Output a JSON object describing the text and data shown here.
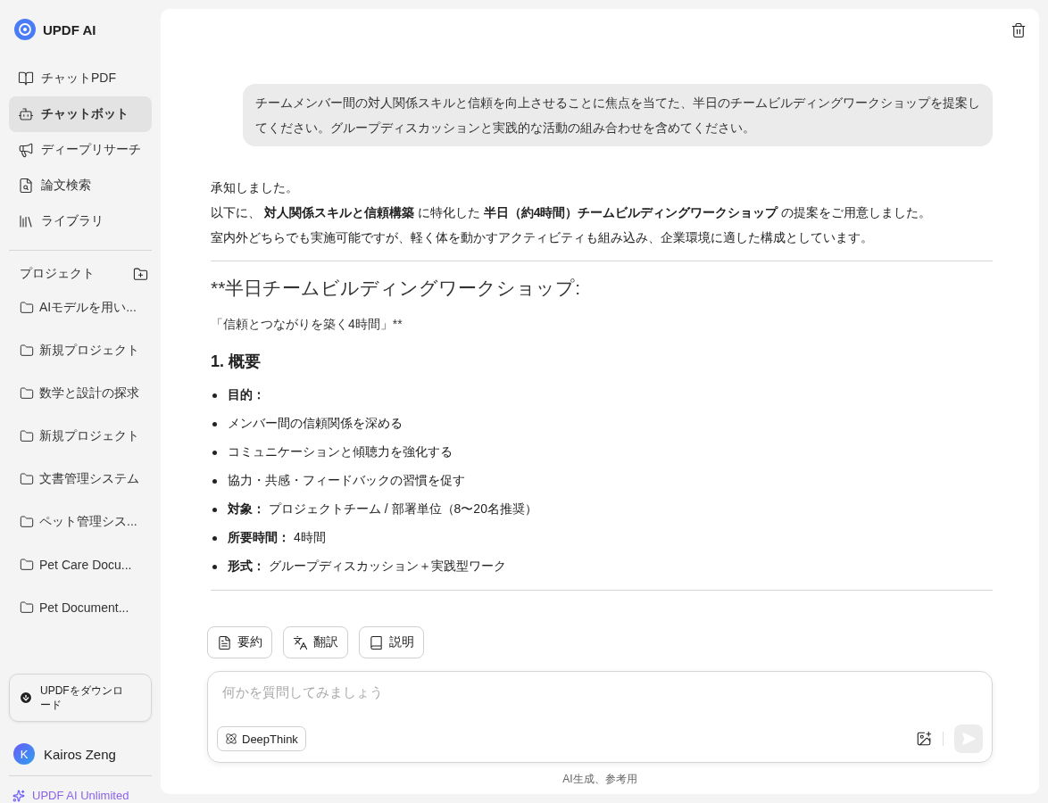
{
  "app": {
    "name": "UPDF AI"
  },
  "nav": [
    {
      "label": "チャットPDF",
      "kind": "pdf",
      "selected": false
    },
    {
      "label": "チャットボット",
      "kind": "bot",
      "selected": true
    },
    {
      "label": "ディープリサーチ",
      "kind": "research",
      "selected": false
    },
    {
      "label": "論文検索",
      "kind": "papers",
      "selected": false
    },
    {
      "label": "ライブラリ",
      "kind": "library",
      "selected": false
    }
  ],
  "projects": {
    "heading": "プロジェクト",
    "items": [
      "AIモデルを用い...",
      "新規プロジェクト",
      "数学と設計の探求",
      "新規プロジェクト",
      "文書管理システム",
      "ペット管理シス...",
      "Pet Care Docu...",
      "Pet Document..."
    ]
  },
  "download": {
    "label": "UPDFをダウンロード"
  },
  "user": {
    "initial": "K",
    "name": "Kairos Zeng"
  },
  "plan": {
    "label": "UPDF AI Unlimited"
  },
  "chat": {
    "user_message": "チームメンバー間の対人関係スキルと信頼を向上させることに焦点を当てた、半日のチームビルディングワークショップを提案してください。グループディスカッションと実践的な活動の組み合わせを含めてください。",
    "intro": [
      "承知しました。",
      "以下に、 **対人関係スキルと信頼構築** に特化した **半日（約4時間）チームビルディングワークショップ** の提案をご用意しました。",
      "室内外どちらでも実施可能ですが、軽く体を動かすアクティビティも組み込み、企業環境に適した構成としています。"
    ],
    "heading": "**半日チームビルディングワークショップ:",
    "subtitle": "「信頼とつながりを築く4時間」**",
    "section": "1. 概要",
    "bullets": [
      "**目的：**",
      "メンバー間の信頼関係を深める",
      "コミュニケーションと傾聴力を強化する",
      "協力・共感・フィードバックの習慣を促す",
      "**対象：** プロジェクトチーム / 部署単位（8〜20名推奨）",
      "**所要時間：** 4時間",
      "**形式：** グループディスカッション＋実践型ワーク"
    ]
  },
  "actions": [
    {
      "label": "要約",
      "kind": "summary"
    },
    {
      "label": "翻訳",
      "kind": "translate"
    },
    {
      "label": "説明",
      "kind": "explain"
    }
  ],
  "composer": {
    "placeholder": "何かを質問してみましょう",
    "mode_button": "DeepThink"
  },
  "footer_note": "AI生成、参考用"
}
